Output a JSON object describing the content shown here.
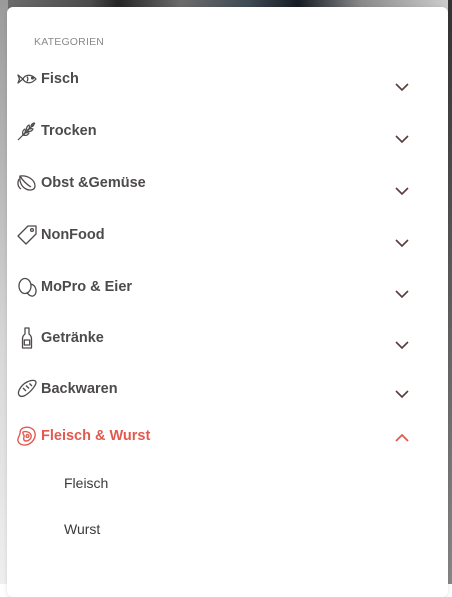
{
  "heading": "KATEGORIEN",
  "colors": {
    "text": "#4d4a4a",
    "active": "#e25a4f",
    "chevron": "#5a3a3a",
    "heading": "#8a8a8a"
  },
  "categories": [
    {
      "label": "Fisch",
      "icon": "fish-icon",
      "expanded": false
    },
    {
      "label": "Trocken",
      "icon": "wheat-icon",
      "expanded": false
    },
    {
      "label": "Obst &Gemüse",
      "icon": "leaf-icon",
      "expanded": false
    },
    {
      "label": "NonFood",
      "icon": "tag-icon",
      "expanded": false
    },
    {
      "label": "MoPro & Eier",
      "icon": "eggs-icon",
      "expanded": false
    },
    {
      "label": "Getränke",
      "icon": "bottle-icon",
      "expanded": false
    },
    {
      "label": "Backwaren",
      "icon": "bread-icon",
      "expanded": false
    },
    {
      "label": "Fleisch & Wurst",
      "icon": "meat-icon",
      "expanded": true
    }
  ],
  "subcategories": [
    "Fleisch",
    "Wurst"
  ]
}
